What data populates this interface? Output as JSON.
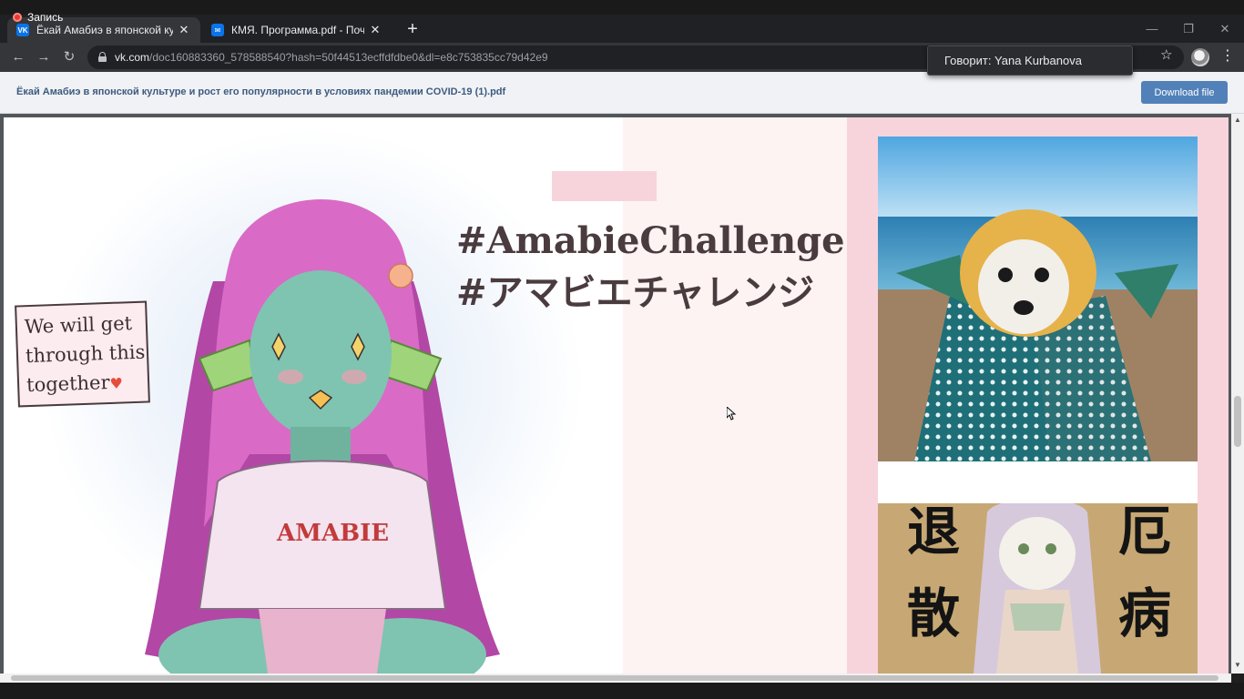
{
  "recording": {
    "label": "Запись"
  },
  "tabs": [
    {
      "title": "Ёкай Амабиэ в японской культу",
      "favicon": "VK",
      "active": true
    },
    {
      "title": "КМЯ. Программа.pdf - Почта M",
      "favicon": "✉",
      "active": false
    }
  ],
  "window_controls": {
    "minimize": "—",
    "restore": "❐",
    "close": "✕"
  },
  "address_bar": {
    "host": "vk.com",
    "path": "/doc160883360_578588540?hash=50f44513ecffdfdbe0&dl=e8c753835cc79d42e9"
  },
  "speaker_tooltip": "Говорит: Yana Kurbanova",
  "doc_header": {
    "title": "Ёкай Амабиэ в японской культуре и рост его популярности в условиях пандемии COVID-19 (1).pdf",
    "download_label": "Download file"
  },
  "slide": {
    "heading_line_1": "#AmabieChallenge",
    "heading_line_2": "#アマビエチャレンジ",
    "note_lines": [
      "We will get",
      "through this",
      "together"
    ],
    "shirt_text": "AMABIE",
    "kanji": {
      "top_left": "退",
      "bottom_left": "散",
      "top_right": "厄",
      "bottom_right": "病"
    }
  },
  "colors": {
    "accent_pink": "#f7d4dc",
    "heading": "#4a3b3f",
    "vk_button": "#5181b8"
  }
}
